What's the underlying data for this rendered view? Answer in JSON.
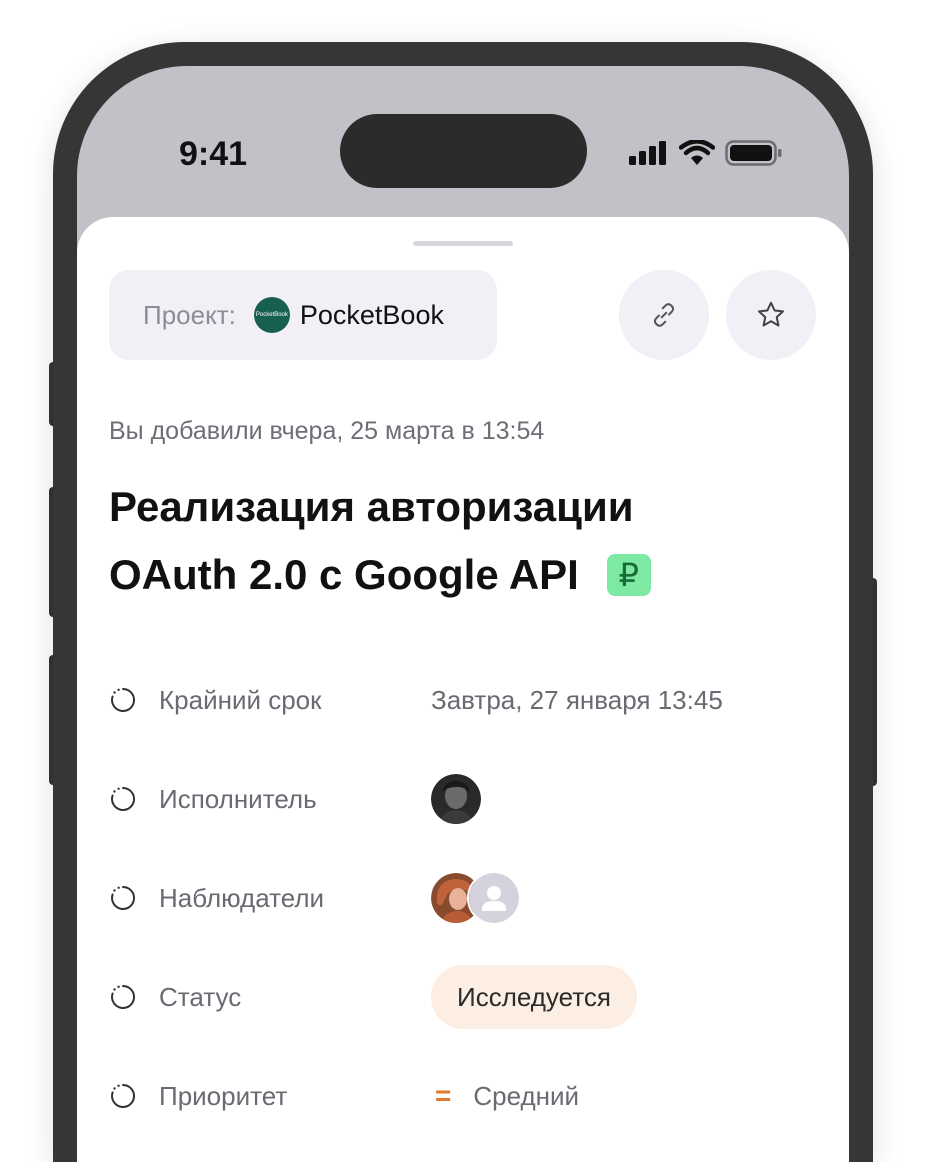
{
  "status_bar": {
    "time": "9:41"
  },
  "project": {
    "label": "Проект:",
    "logo_text": "PocketBook",
    "name": "PocketBook"
  },
  "actions": {
    "link_icon": "link-icon",
    "favorite_icon": "star-icon"
  },
  "task": {
    "added_text": "Вы добавили вчера, 25 марта в 13:54",
    "title_line1": "Реализация авторизации",
    "title_line2": "OAuth 2.0  с Google API",
    "badge_symbol": "₽"
  },
  "properties": {
    "deadline": {
      "label": "Крайний срок",
      "value": "Завтра, 27 января  13:45"
    },
    "assignee": {
      "label": "Исполнитель"
    },
    "watchers": {
      "label": "Наблюдатели"
    },
    "status": {
      "label": "Статус",
      "value": "Исследуется"
    },
    "priority": {
      "label": "Приоритет",
      "icon": "=",
      "value": "Средний"
    }
  },
  "colors": {
    "accent_status_bg": "#fdeee4",
    "priority_icon": "#e07a2a",
    "badge_bg": "#7ee9a2",
    "logo_bg": "#17604f"
  }
}
